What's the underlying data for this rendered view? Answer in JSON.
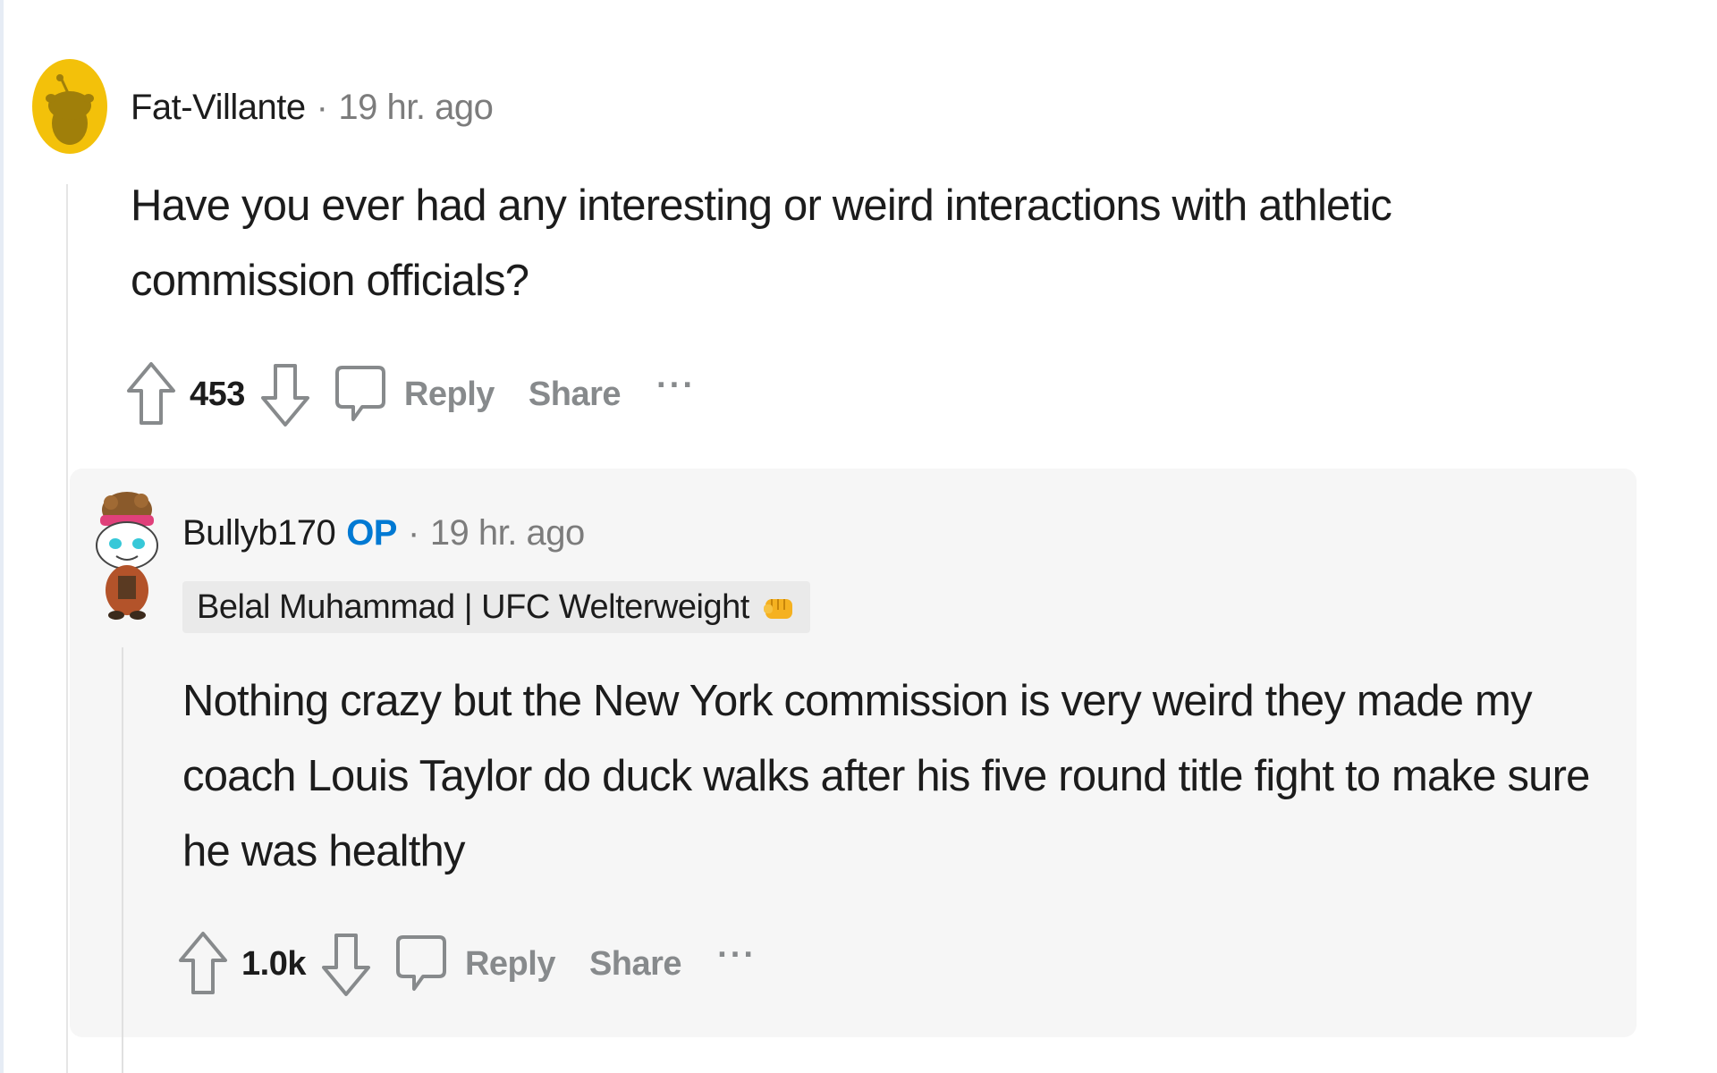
{
  "colors": {
    "op_blue": "#0079d3",
    "muted_gray": "#7c7c7c",
    "action_gray": "#878a8c",
    "text": "#1c1c1c",
    "reply_bg": "#f6f6f6",
    "avatar_yellow": "#f3c10a"
  },
  "parent_comment": {
    "author": "Fat-Villante",
    "separator": "·",
    "time": "19 hr. ago",
    "avatar_icon": "snoo-yellow-avatar-icon",
    "body": "Have you ever had any interesting or weird interactions with athletic commission officials?",
    "score": "453",
    "reply_label": "Reply",
    "share_label": "Share",
    "more_label": "···"
  },
  "reply_comment": {
    "author": "Bullyb170",
    "op_badge": "OP",
    "separator": "·",
    "time": "19 hr. ago",
    "avatar_icon": "snoo-custom-avatar-icon",
    "flair": "Belal Muhammad | UFC Welterweight",
    "flair_icon": "fist-emoji-icon",
    "body": "Nothing crazy but the New York commission is very weird they made my coach Louis Taylor do duck walks after his five round title fight to make sure he was healthy",
    "score": "1.0k",
    "reply_label": "Reply",
    "share_label": "Share",
    "more_label": "···"
  }
}
